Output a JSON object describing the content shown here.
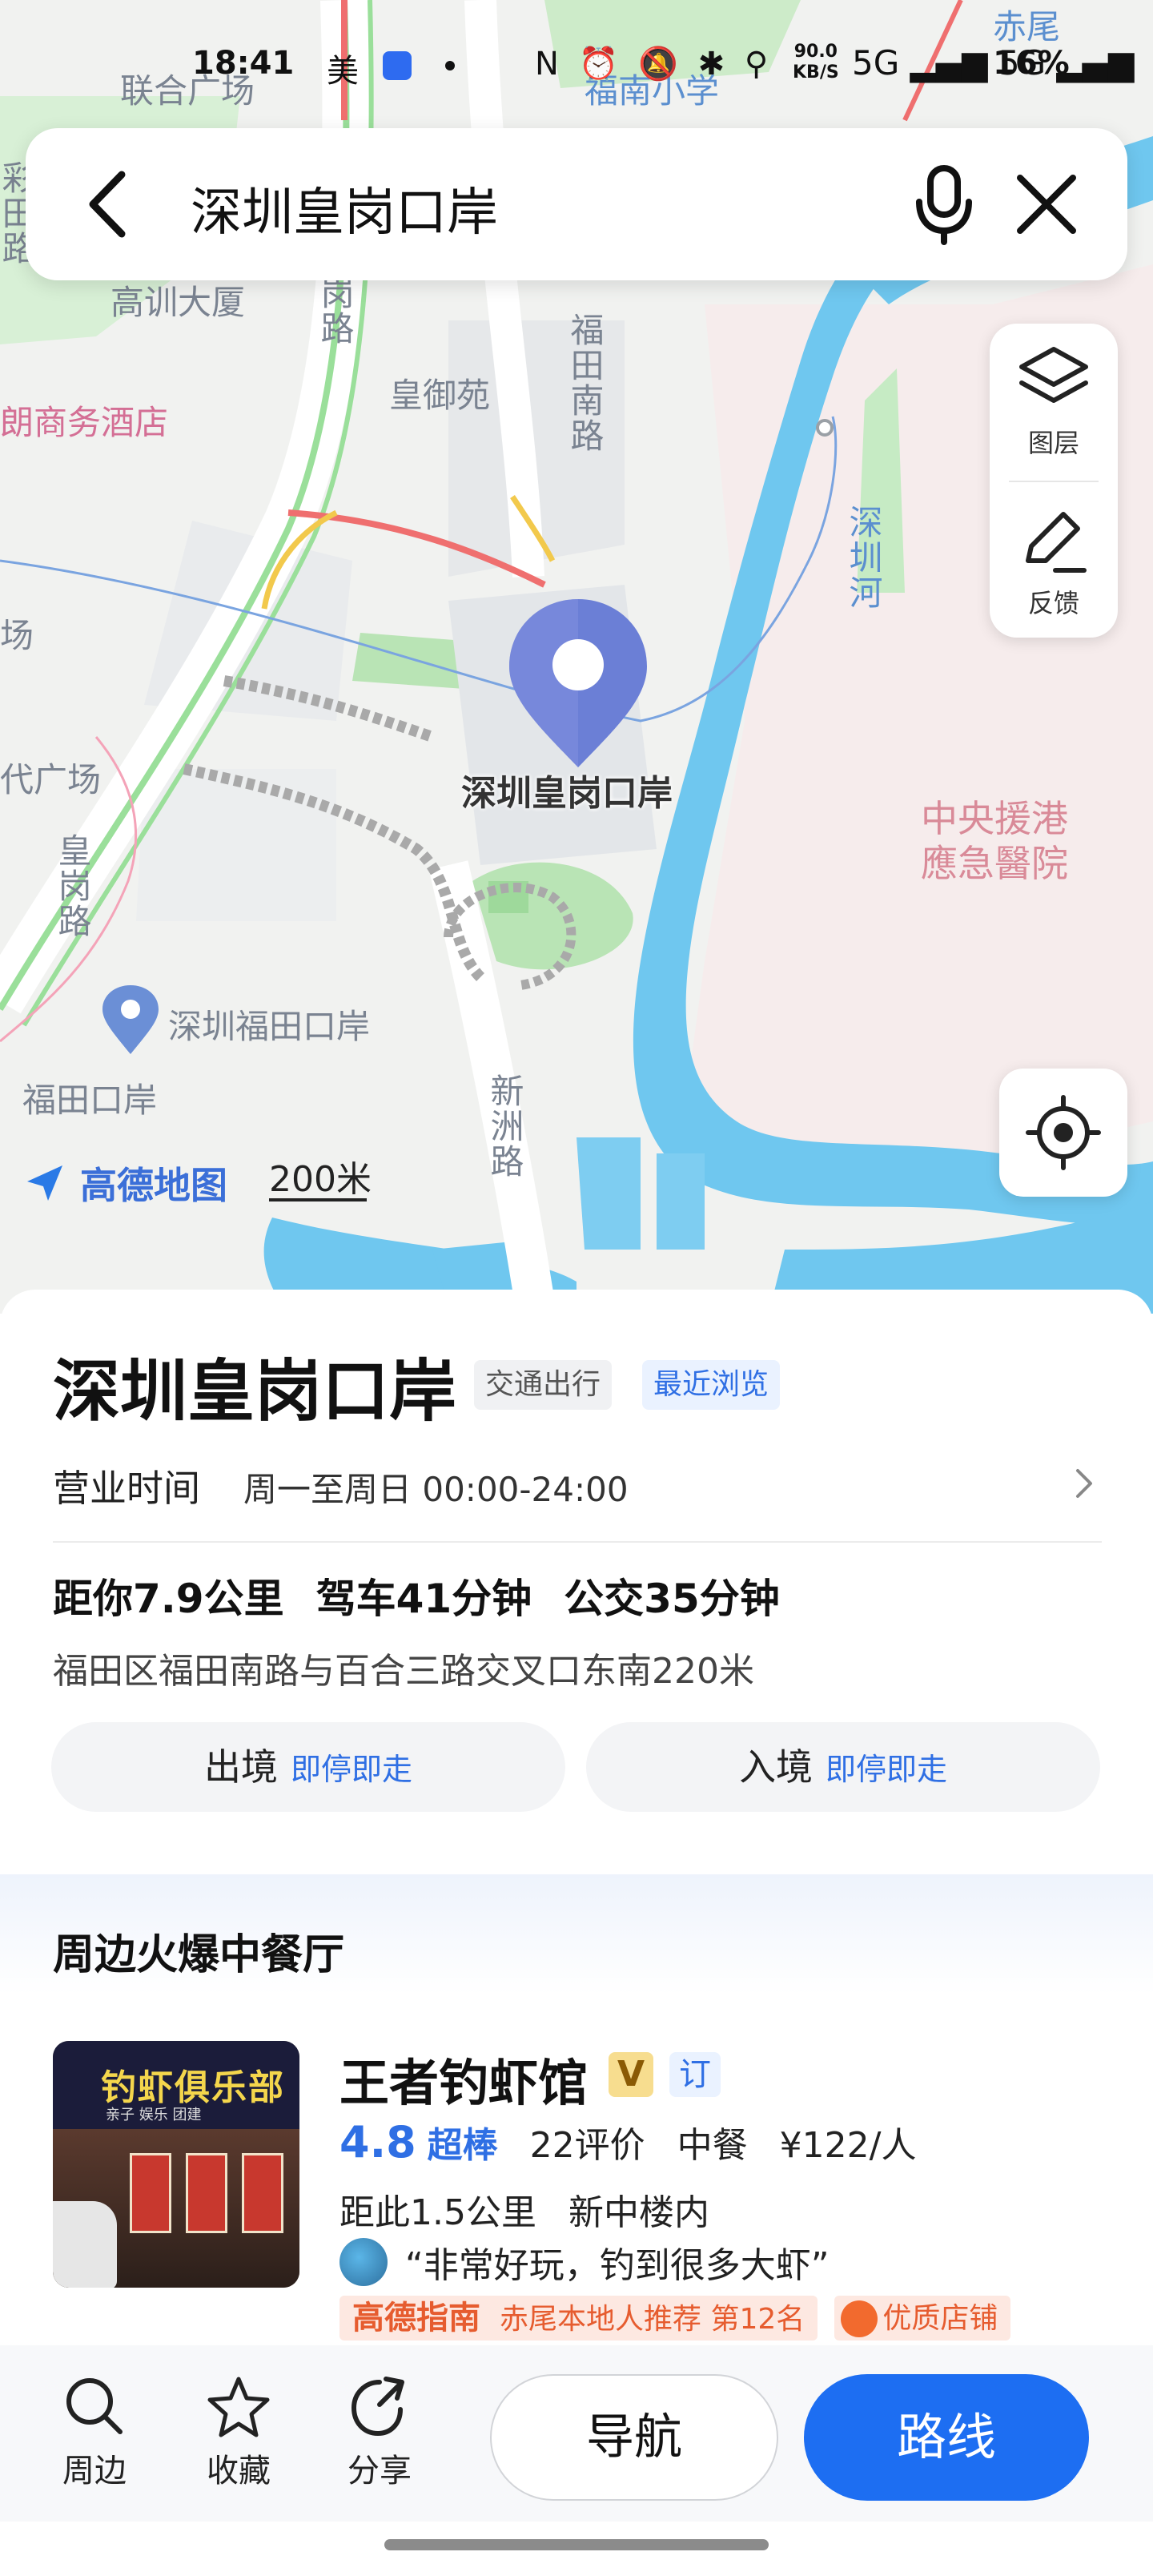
{
  "status_bar": {
    "time": "18:41",
    "app_label": "美",
    "icons_text": "N ⏰ 🔕 ✱ ⚲",
    "speed_value": "90.0",
    "speed_unit": "KB/S",
    "signal_text": "5G ▂▄▆ 5G ▂▄▆",
    "battery": "16%"
  },
  "search": {
    "query": "深圳皇岗口岸",
    "back_icon": "back-arrow-icon",
    "mic_icon": "microphone-icon",
    "close_icon": "close-icon"
  },
  "map": {
    "labels": {
      "lianhe": "联合广场",
      "fujian_school": "福南小学",
      "chiwei": "赤尾",
      "gaoxun": "高训大厦",
      "hotel": "朗商务酒店",
      "huangyuyuan": "皇御苑",
      "futian_road": "福田南路",
      "huanggang_road_top": "岗路",
      "huanggang_road_left": "皇岗路",
      "shenzhen_river": "深圳河",
      "hospital": "中央援港應急醫院",
      "plaza": "代广场",
      "futian_port": "深圳福田口岸",
      "futian_port_station": "福田口岸",
      "xinzhou_road": "新洲路",
      "left_edge": "彩田路",
      "chang": "场"
    },
    "pin_label": "深圳皇岗口岸",
    "logo_text": "高德地图",
    "scale_text": "200米",
    "tools": [
      {
        "label": "图层",
        "icon": "layers-icon"
      },
      {
        "label": "反馈",
        "icon": "edit-feedback-icon"
      }
    ],
    "locate_icon": "locate-icon"
  },
  "place": {
    "title": "深圳皇岗口岸",
    "tags": [
      "交通出行",
      "最近浏览"
    ],
    "hours_label": "营业时间",
    "hours_value": "周一至周日 00:00-24:00",
    "distance": "距你7.9公里",
    "drive": "驾车41分钟",
    "transit": "公交35分钟",
    "address": "福田区福田南路与百合三路交叉口东南220米",
    "exit": {
      "label": "出境",
      "sub": "即停即走"
    },
    "entry": {
      "label": "入境",
      "sub": "即停即走"
    }
  },
  "nearby": {
    "heading": "周边火爆中餐厅",
    "restaurant": {
      "thumb_sign": "钓虾俱乐部",
      "thumb_sub": "亲子 娱乐 团建",
      "name": "王者钓虾馆",
      "v_badge": "V",
      "ding_badge": "订",
      "score": "4.8",
      "score_text": "超棒",
      "reviews": "22评价",
      "cuisine": "中餐",
      "price": "¥122/人",
      "distance": "距此1.5公里",
      "location": "新中楼内",
      "quote": "“非常好玩，钓到很多大虾”",
      "guide_brand": "高德指南",
      "guide_rec": "赤尾本地人推荐 第12名",
      "quality": "优质店铺"
    }
  },
  "actions": {
    "nearby": "周边",
    "favorite": "收藏",
    "share": "分享",
    "navigate": "导航",
    "route": "路线"
  },
  "colors": {
    "accent": "#1d6ef2",
    "pin": "#6b7fd6",
    "water": "#6fc7ef",
    "green": "#c9ecc9"
  }
}
